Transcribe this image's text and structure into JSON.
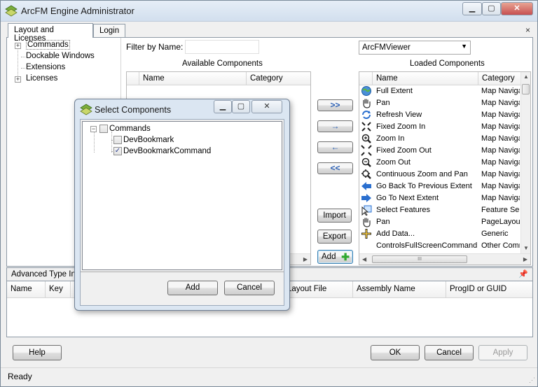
{
  "window": {
    "title": "ArcFM Engine Administrator"
  },
  "tabs": [
    {
      "label": "Layout and Licenses"
    },
    {
      "label": "Login"
    }
  ],
  "tab_close_glyph": "×",
  "tree": {
    "items": [
      {
        "label": "Commands",
        "expandable": true
      },
      {
        "label": "Dockable Windows",
        "expandable": false
      },
      {
        "label": "Extensions",
        "expandable": false
      },
      {
        "label": "Licenses",
        "expandable": true
      }
    ]
  },
  "filter": {
    "label": "Filter by Name:",
    "value": ""
  },
  "viewer_combo": {
    "selected": "ArcFMViewer"
  },
  "available": {
    "title": "Available Components",
    "columns": [
      "Name",
      "Category"
    ]
  },
  "loaded": {
    "title": "Loaded Components",
    "columns": [
      "Name",
      "Category"
    ],
    "rows": [
      {
        "name": "Full Extent",
        "category": "Map Navigation",
        "icon": "globe-icon"
      },
      {
        "name": "Pan",
        "category": "Map Navigation",
        "icon": "hand-icon"
      },
      {
        "name": "Refresh View",
        "category": "Map Navigation",
        "icon": "refresh-icon"
      },
      {
        "name": "Fixed Zoom In",
        "category": "Map Navigation",
        "icon": "fixed-zoom-in-icon"
      },
      {
        "name": "Zoom In",
        "category": "Map Navigation",
        "icon": "zoom-in-icon"
      },
      {
        "name": "Fixed Zoom Out",
        "category": "Map Navigation",
        "icon": "fixed-zoom-out-icon"
      },
      {
        "name": "Zoom Out",
        "category": "Map Navigation",
        "icon": "zoom-out-icon"
      },
      {
        "name": "Continuous Zoom and Pan",
        "category": "Map Navigation",
        "icon": "continuous-zoom-icon"
      },
      {
        "name": "Go Back To Previous Extent",
        "category": "Map Navigation",
        "icon": "arrow-left-icon"
      },
      {
        "name": "Go To Next Extent",
        "category": "Map Navigation",
        "icon": "arrow-right-icon"
      },
      {
        "name": "Select Features",
        "category": "Feature Selection",
        "icon": "select-features-icon"
      },
      {
        "name": "Pan",
        "category": "PageLayout",
        "icon": "hand-icon"
      },
      {
        "name": "Add Data...",
        "category": "Generic",
        "icon": "add-data-icon"
      },
      {
        "name": "ControlsFullScreenCommand",
        "category": "Other Commands",
        "icon": ""
      }
    ],
    "hscroll_grip": "III"
  },
  "transfer_buttons": {
    "add_all": ">>",
    "add": "→",
    "remove": "←",
    "remove_all": "<<"
  },
  "action_buttons": {
    "import": "Import",
    "export": "Export",
    "add": "Add"
  },
  "advanced": {
    "title": "Advanced Type Info",
    "columns": [
      "Name",
      "Key",
      "Layout File",
      "Assembly Name",
      "ProgID or GUID"
    ]
  },
  "footer": {
    "help": "Help",
    "ok": "OK",
    "cancel": "Cancel",
    "apply": "Apply"
  },
  "status": {
    "text": "Ready"
  },
  "dialog": {
    "title": "Select Components",
    "tree": {
      "root": {
        "label": "Commands",
        "checked": false
      },
      "children": [
        {
          "label": "DevBookmark",
          "checked": false
        },
        {
          "label": "DevBookmarkCommand",
          "checked": true
        }
      ]
    },
    "add_label": "Add",
    "cancel_label": "Cancel"
  },
  "colors": {
    "accent": "#2a5fb4",
    "close_red": "#c75050",
    "plus_green": "#2fa82f"
  }
}
